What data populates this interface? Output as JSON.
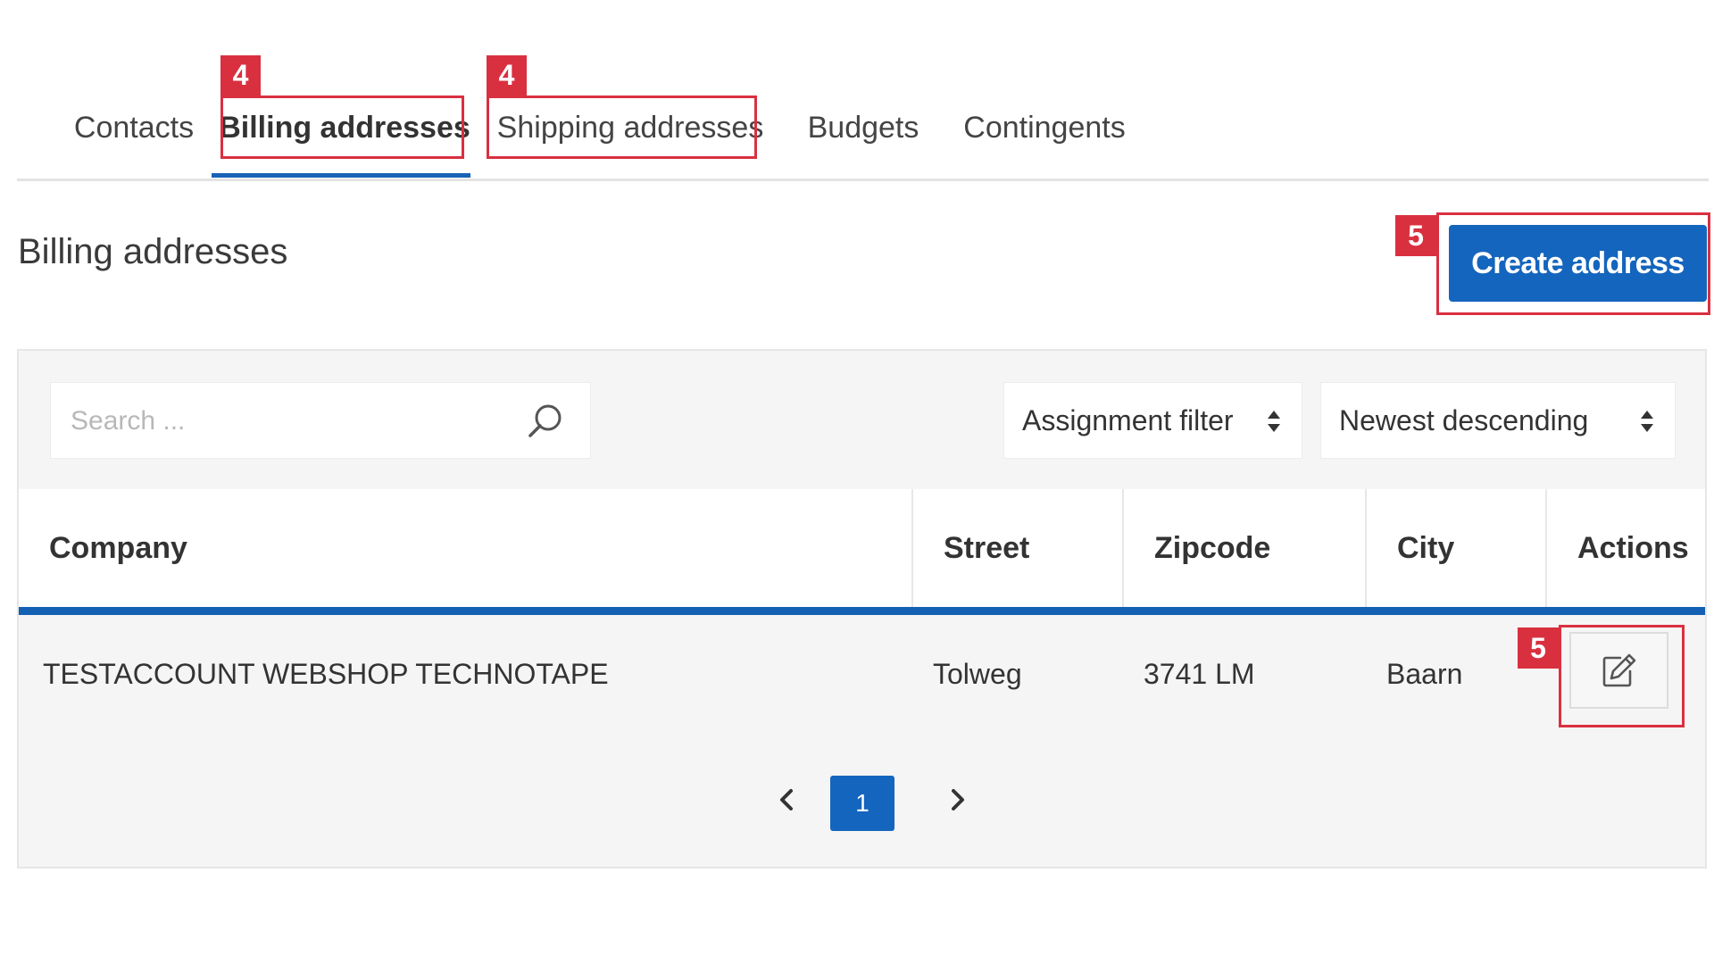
{
  "tabs": [
    {
      "label": "Contacts"
    },
    {
      "label": "Billing addresses",
      "active": true
    },
    {
      "label": "Shipping addresses"
    },
    {
      "label": "Budgets"
    },
    {
      "label": "Contingents"
    }
  ],
  "markers": {
    "billing_tab": "4",
    "shipping_tab": "4",
    "create_button": "5",
    "edit_button": "5"
  },
  "page": {
    "title": "Billing addresses",
    "create_label": "Create address"
  },
  "toolbar": {
    "search_placeholder": "Search ...",
    "assignment_filter": "Assignment filter",
    "sort": "Newest descending"
  },
  "table": {
    "headers": [
      "Company",
      "Street",
      "Zipcode",
      "City",
      "Actions"
    ],
    "rows": [
      {
        "company": "TESTACCOUNT WEBSHOP TECHNOTAPE",
        "street": "Tolweg",
        "zipcode": "3741 LM",
        "city": "Baarn"
      }
    ]
  },
  "pagination": {
    "current_page": "1"
  },
  "colors": {
    "primary": "#1465bd",
    "annotation": "#d93040"
  },
  "icons": {
    "search": "search-icon",
    "select_caret": "sort-caret-icon",
    "edit": "edit-icon",
    "prev": "chevron-left-icon",
    "next": "chevron-right-icon"
  }
}
